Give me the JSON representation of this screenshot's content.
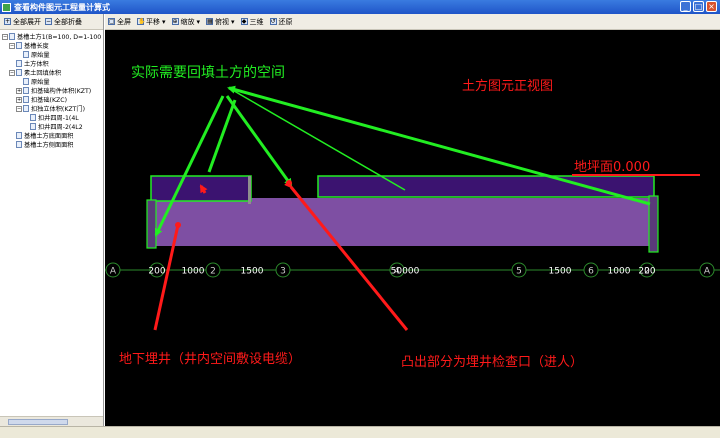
{
  "window": {
    "title": "查看构件图元工程量计算式",
    "minimize": "_",
    "maximize": "□",
    "close": "×"
  },
  "left_toolbar": {
    "expand_all": "全部展开",
    "collapse_all": "全部折叠"
  },
  "tree": [
    {
      "label": "基槽土方1(B=100, D=1-100",
      "level": 0,
      "expander": "−",
      "icon": "doc"
    },
    {
      "label": "基槽长度",
      "level": 1,
      "expander": "−",
      "icon": "doc"
    },
    {
      "label": "原始量",
      "level": 2,
      "expander": "",
      "icon": "doc"
    },
    {
      "label": "土方体积",
      "level": 1,
      "expander": "",
      "icon": "doc"
    },
    {
      "label": "素土回填体积",
      "level": 1,
      "expander": "−",
      "icon": "doc"
    },
    {
      "label": "原始量",
      "level": 2,
      "expander": "",
      "icon": "doc"
    },
    {
      "label": "扣基础构件体积(KZT)",
      "level": 2,
      "expander": "+",
      "icon": "doc"
    },
    {
      "label": "扣基础(KZC)",
      "level": 2,
      "expander": "+",
      "icon": "doc"
    },
    {
      "label": "扣独立体积(KZT门)",
      "level": 2,
      "expander": "−",
      "icon": "doc"
    },
    {
      "label": "扣井四周-1(4L",
      "level": 3,
      "expander": "",
      "icon": "doc"
    },
    {
      "label": "扣井四周-2(4L2",
      "level": 3,
      "expander": "",
      "icon": "doc"
    },
    {
      "label": "基槽土方底面面积",
      "level": 1,
      "expander": "",
      "icon": "doc"
    },
    {
      "label": "基槽土方侧面面积",
      "level": 1,
      "expander": "",
      "icon": "doc"
    }
  ],
  "main_toolbar": {
    "full_screen": "全屏",
    "pan": "平移",
    "zoom": "缩放",
    "top_view": "俯视",
    "three_d": "三维",
    "restore": "还原"
  },
  "drawing": {
    "axis_labels": [
      "A",
      "2",
      "3",
      "4",
      "5",
      "6",
      "2",
      "A"
    ],
    "dimensions": [
      "200",
      "1000",
      "1500",
      "50000",
      "1500",
      "1000",
      "200"
    ],
    "annotations": {
      "space_to_backfill": "实际需要回填土方的空间",
      "front_view": "土方图元正视图",
      "ground_level": "地坪面0.000",
      "underground_well": "地下埋井（井内空间敷设电缆）",
      "inspection_port": "凸出部分为埋井检查口（进人）"
    }
  },
  "colors": {
    "background": "#000000",
    "earthwork": "#7e4fa3",
    "upper_band": "#3b1370",
    "outline": "#22ee22",
    "annotation_red": "#ff1a1a",
    "annotation_green": "#22ee22"
  }
}
